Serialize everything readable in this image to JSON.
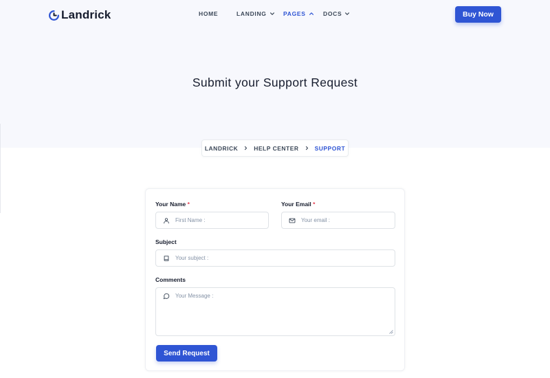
{
  "brand": {
    "name": "Landrick",
    "accent": "#2f55d4"
  },
  "nav": {
    "items": [
      {
        "label": "HOME",
        "has_dropdown": false,
        "active": false
      },
      {
        "label": "LANDING",
        "has_dropdown": true,
        "active": false
      },
      {
        "label": "PAGES",
        "has_dropdown": true,
        "active": true
      },
      {
        "label": "DOCS",
        "has_dropdown": true,
        "active": false
      }
    ],
    "buy_label": "Buy Now"
  },
  "hero": {
    "title": "Submit your Support Request"
  },
  "breadcrumb": {
    "items": [
      "LANDRICK",
      "HELP CENTER",
      "SUPPORT"
    ]
  },
  "form": {
    "name": {
      "label": "Your Name",
      "required_mark": "*",
      "placeholder": "First Name :",
      "icon": "user-icon"
    },
    "email": {
      "label": "Your Email",
      "required_mark": "*",
      "placeholder": "Your email :",
      "icon": "mail-icon"
    },
    "subject": {
      "label": "Subject",
      "placeholder": "Your subject :",
      "icon": "book-icon"
    },
    "comments": {
      "label": "Comments",
      "placeholder": "Your Message :",
      "icon": "message-circle-icon"
    },
    "submit_label": "Send Request"
  }
}
